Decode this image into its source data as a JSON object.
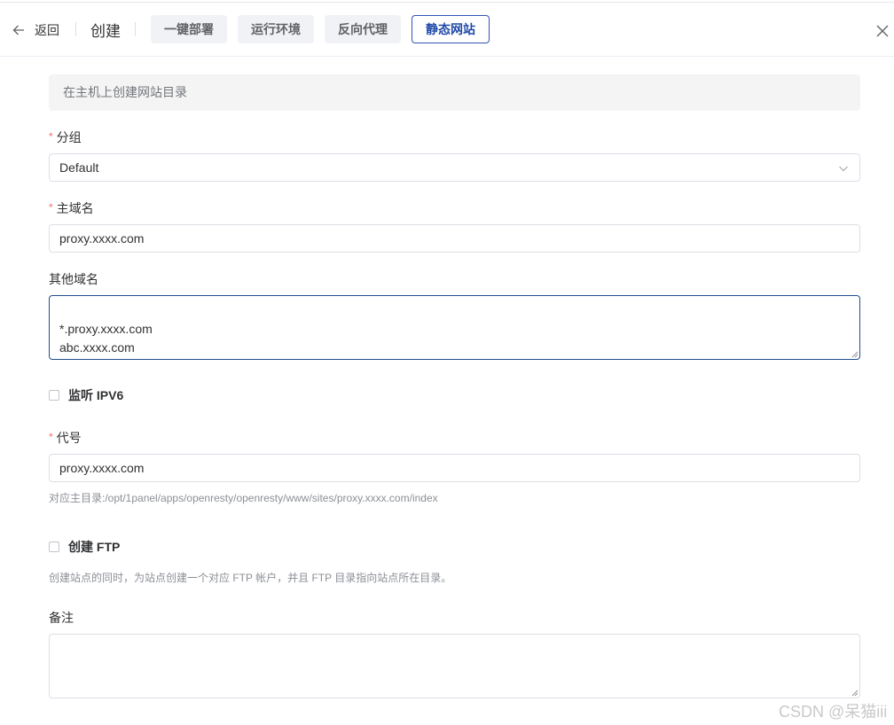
{
  "header": {
    "back_label": "返回",
    "title": "创建",
    "tabs": [
      {
        "label": "一键部署"
      },
      {
        "label": "运行环境"
      },
      {
        "label": "反向代理"
      },
      {
        "label": "静态网站"
      }
    ],
    "active_tab": "静态网站"
  },
  "notice": "在主机上创建网站目录",
  "form": {
    "required_mark": "*",
    "group": {
      "label": "分组",
      "value": "Default"
    },
    "primary_domain": {
      "label": "主域名",
      "value": "proxy.xxxx.com"
    },
    "other_domains": {
      "label": "其他域名",
      "value": "*.proxy.xxxx.com\nabc.xxxx.com"
    },
    "ipv6": {
      "label": "监听 IPV6",
      "checked": false
    },
    "alias": {
      "label": "代号",
      "value": "proxy.xxxx.com",
      "hint": "对应主目录:/opt/1panel/apps/openresty/openresty/www/sites/proxy.xxxx.com/index"
    },
    "ftp": {
      "label": "创建 FTP",
      "checked": false,
      "hint": "创建站点的同时，为站点创建一个对应 FTP 帐户，并且 FTP 目录指向站点所在目录。"
    },
    "remark": {
      "label": "备注",
      "value": ""
    }
  },
  "watermark": "CSDN @呆猫iii",
  "colors": {
    "accent": "#1f49a8",
    "required": "#f56c6c",
    "border": "#dcdfe6"
  }
}
